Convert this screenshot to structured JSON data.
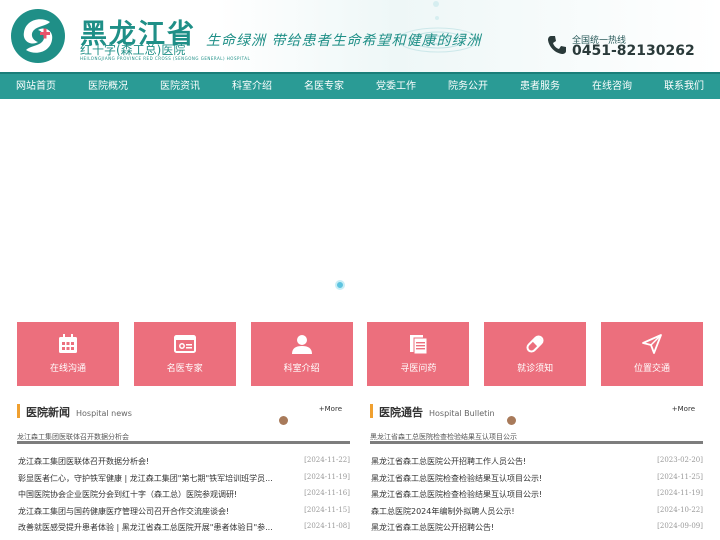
{
  "header": {
    "title": "黑龙江省",
    "subtitle": "红十字(森工总)医院",
    "english": "HEILONGJIANG PROVINCE RED CROSS (SENGONG GENERAL) HOSPITAL",
    "slogan": "生命绿洲  带给患者生命希望和健康的绿洲",
    "hotline_label": "全国统一热线",
    "hotline_number": "0451-82130262"
  },
  "nav": {
    "items": [
      "网站首页",
      "医院概况",
      "医院资讯",
      "科室介绍",
      "名医专家",
      "党委工作",
      "院务公开",
      "患者服务",
      "在线咨询",
      "联系我们"
    ]
  },
  "quick_links": [
    {
      "label": "在线沟通",
      "icon": "calendar-icon"
    },
    {
      "label": "名医专家",
      "icon": "browser-icon"
    },
    {
      "label": "科室介绍",
      "icon": "person-icon"
    },
    {
      "label": "寻医问药",
      "icon": "document-icon"
    },
    {
      "label": "就诊须知",
      "icon": "pill-icon"
    },
    {
      "label": "位置交通",
      "icon": "paper-plane-icon"
    }
  ],
  "news": {
    "title": "医院新闻",
    "english": "Hospital news",
    "more": "+More",
    "image_alt": "龙江森工集团医联体召开数据分析会",
    "items": [
      {
        "title": "龙江森工集团医联体召开数据分析会!",
        "date": "[2024-11-22]"
      },
      {
        "title": "彰显医者仁心，守护铁军健康 | 龙江森工集团\"第七期\"铁军培训班学员...",
        "date": "[2024-11-19]"
      },
      {
        "title": "中国医院协会企业医院分会到红十字（森工总）医院参观调研!",
        "date": "[2024-11-16]"
      },
      {
        "title": "龙江森工集团与国药健康医疗管理公司召开合作交流座谈会!",
        "date": "[2024-11-15]"
      },
      {
        "title": "改善就医感受提升患者体验 | 黑龙江省森工总医院开展\"患者体验日\"参...",
        "date": "[2024-11-08]"
      }
    ]
  },
  "bulletin": {
    "title": "医院通告",
    "english": "Hospital Bulletin",
    "more": "+More",
    "image_alt": "黑龙江省森工总医院检查检验结果互认项目公示",
    "items": [
      {
        "title": "黑龙江省森工总医院公开招聘工作人员公告!",
        "date": "[2023-02-20]"
      },
      {
        "title": "黑龙江省森工总医院检查检验结果互认项目公示!",
        "date": "[2024-11-25]"
      },
      {
        "title": "黑龙江省森工总医院检查检验结果互认项目公示!",
        "date": "[2024-11-19]"
      },
      {
        "title": "森工总医院2024年编制外拟聘人员公示!",
        "date": "[2024-10-22]"
      },
      {
        "title": "黑龙江省森工总医院公开招聘公告!",
        "date": "[2024-09-09]"
      }
    ]
  },
  "colors": {
    "brand": "#2a9b95",
    "quick_link_bg": "#ec6f7d",
    "accent_bar": "#f0a030"
  }
}
